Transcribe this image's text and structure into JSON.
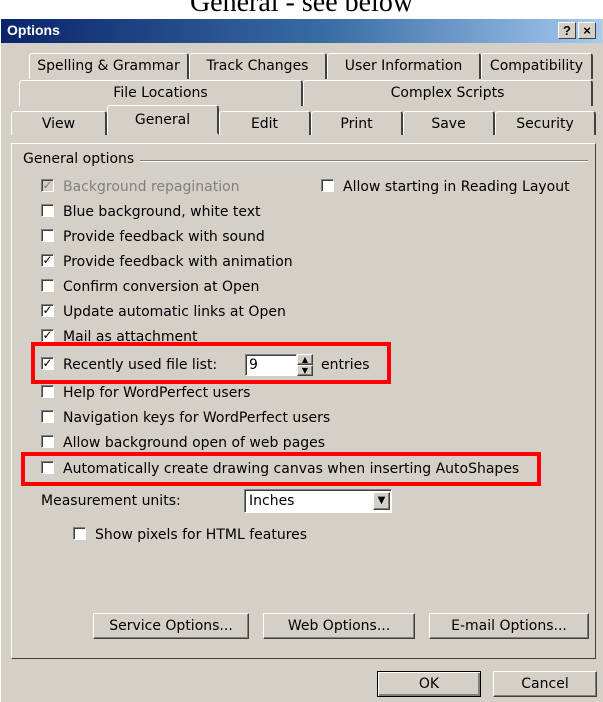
{
  "caption": "General - see below",
  "window": {
    "title": "Options",
    "help_glyph": "?",
    "close_glyph": "×"
  },
  "tabs": {
    "row1": [
      "Spelling & Grammar",
      "Track Changes",
      "User Information",
      "Compatibility"
    ],
    "row2": [
      "File Locations",
      "Complex Scripts"
    ],
    "row3": [
      "View",
      "General",
      "Edit",
      "Print",
      "Save",
      "Security"
    ],
    "active": "General"
  },
  "group_label": "General options",
  "options": [
    {
      "label": "Background repagination",
      "checked": true,
      "disabled": true
    },
    {
      "label": "Blue background, white text",
      "checked": false
    },
    {
      "label": "Provide feedback with sound",
      "checked": false
    },
    {
      "label": "Provide feedback with animation",
      "checked": true
    },
    {
      "label": "Confirm conversion at Open",
      "checked": false
    },
    {
      "label": "Update automatic links at Open",
      "checked": true
    },
    {
      "label": "Mail as attachment",
      "checked": true
    },
    {
      "label": "Recently used file list:",
      "checked": true
    },
    {
      "label": "Help for WordPerfect users",
      "checked": false
    },
    {
      "label": "Navigation keys for WordPerfect users",
      "checked": false
    },
    {
      "label": "Allow background open of web pages",
      "checked": false
    },
    {
      "label": "Automatically create drawing canvas when inserting AutoShapes",
      "checked": false
    }
  ],
  "reading_layout": {
    "label": "Allow starting in Reading Layout",
    "checked": false
  },
  "recent_files": {
    "value": "9",
    "suffix": "entries"
  },
  "measurement": {
    "label": "Measurement units:",
    "value": "Inches"
  },
  "show_pixels": {
    "label": "Show pixels for HTML features",
    "checked": false
  },
  "buttons": {
    "service": "Service Options...",
    "web": "Web Options...",
    "email": "E-mail Options...",
    "ok": "OK",
    "cancel": "Cancel"
  },
  "highlight_color": "#ff0000"
}
